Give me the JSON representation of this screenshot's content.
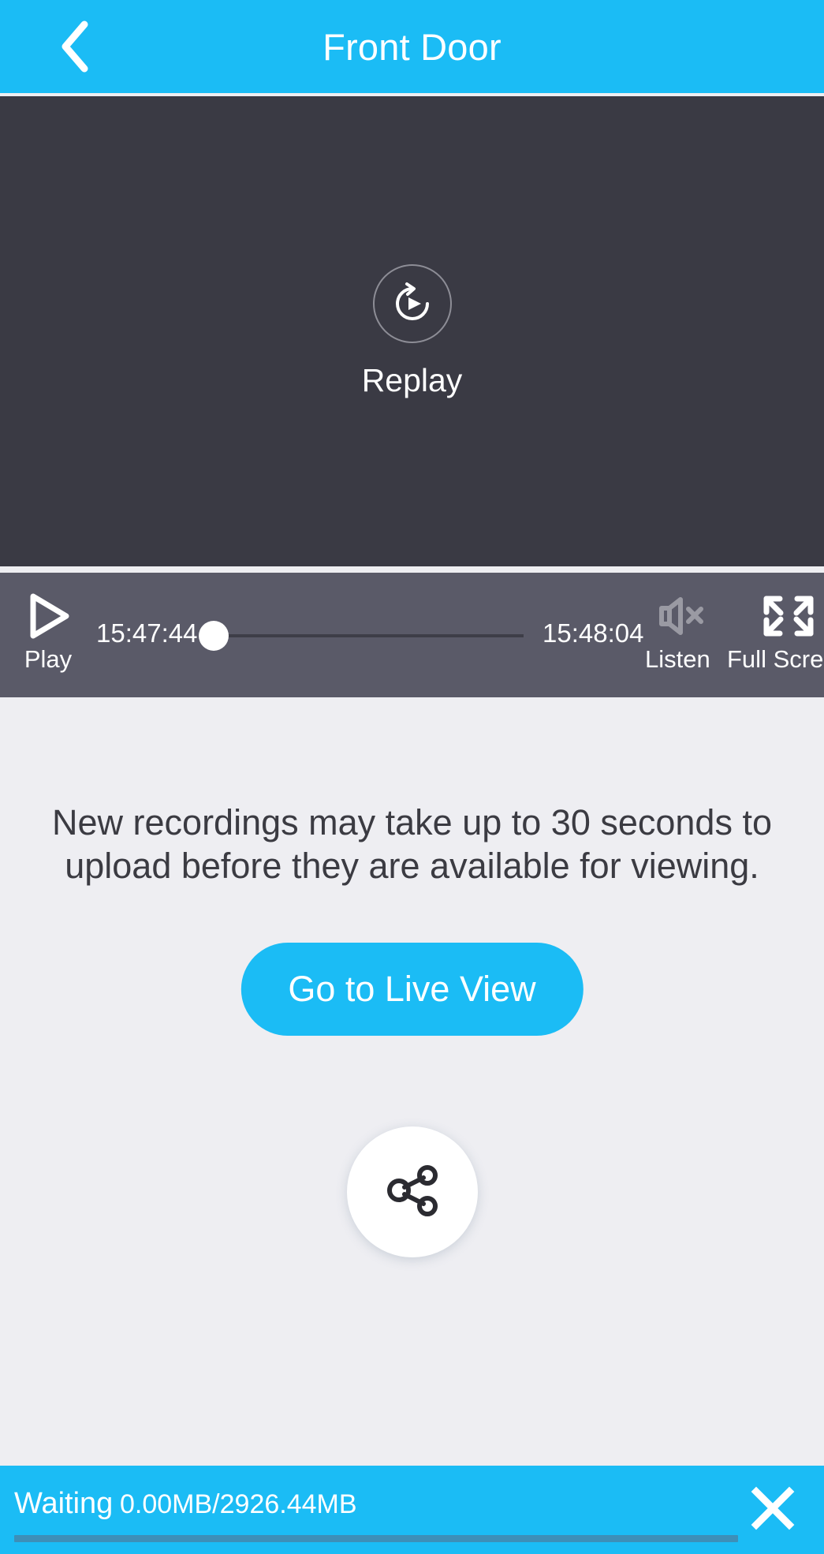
{
  "theme": {
    "accent": "#1bbcf5",
    "video_bg": "#3a3a44",
    "control_bg": "#5a5a68",
    "page_bg": "#eeeef2",
    "progress_track": "#3d8fb8",
    "muted_icon": "#9a9aa3"
  },
  "header": {
    "title": "Front Door",
    "back_icon": "chevron-left-icon"
  },
  "video": {
    "overlay_label": "Replay",
    "overlay_icon": "replay-icon"
  },
  "controls": {
    "play": {
      "label": "Play",
      "icon": "play-triangle-icon"
    },
    "time_start": "15:47:44",
    "time_end": "15:48:04",
    "seek_position_percent": 0,
    "listen": {
      "label": "Listen",
      "icon": "speaker-muted-icon",
      "muted": "true"
    },
    "fullscreen": {
      "label": "Full Screen",
      "icon": "fullscreen-expand-icon"
    }
  },
  "main": {
    "notice": "New recordings may take up to 30 seconds to upload before they are available for viewing.",
    "live_button_label": "Go to Live View",
    "share_button_icon": "share-nodes-icon"
  },
  "statusbar": {
    "state": "Waiting",
    "size": "0.00MB/2926.44MB",
    "progress_percent": 0,
    "close_icon": "close-x-icon"
  }
}
